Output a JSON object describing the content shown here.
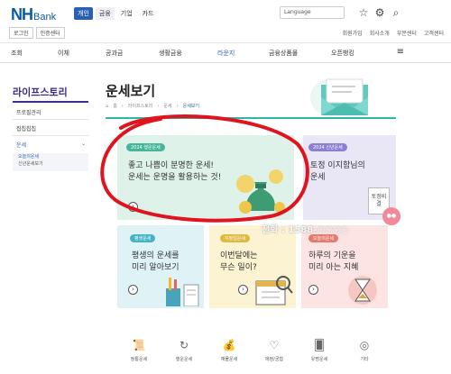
{
  "header": {
    "logo_main": "NH",
    "logo_sub": "Bank",
    "segments": [
      "개인",
      "금융",
      "기업",
      "카드"
    ],
    "login_buttons": [
      "로그인",
      "인증센터"
    ],
    "search_select": "Language",
    "util_links": [
      "회원가입",
      "회사소개",
      "부문센터",
      "고객센터"
    ]
  },
  "gnb": {
    "items": [
      "조회",
      "이체",
      "공과금",
      "생활금융",
      "라운지",
      "금융상품몰",
      "오픈뱅킹"
    ]
  },
  "sidebar": {
    "title": "라이프스토리",
    "items": [
      "프로필관리",
      "칩칩칩칩",
      "운세"
    ],
    "sub_items": [
      "오늘의운세",
      "신년운세보기"
    ]
  },
  "main": {
    "title": "운세보기",
    "breadcrumb": [
      "홈",
      "라이프스토리",
      "운세",
      "운세보기"
    ]
  },
  "cards": [
    {
      "badge": "2024 행운운세",
      "lines": [
        "좋고 나쁨이 분명한 운세!",
        "운세는 운명을 활용하는 것!"
      ],
      "button": "›"
    },
    {
      "badge": "2024 신년운세",
      "lines": [
        "토정 이지함님의",
        "운세"
      ],
      "button": "›",
      "book_label": "토정비결"
    },
    {
      "badge": "평생운세",
      "lines": [
        "평생의 운세를",
        "미리 알아보기"
      ],
      "button": "›"
    },
    {
      "badge": "지정일운세",
      "lines": [
        "이번달에는",
        "무슨 일이?"
      ],
      "button": "›"
    },
    {
      "badge": "오늘의운세",
      "lines": [
        "하루의 기운을",
        "미리 아는 지혜"
      ],
      "button": "›"
    }
  ],
  "footer_icons": [
    {
      "label": "정통운세",
      "icon": "scroll-icon"
    },
    {
      "label": "행운운세",
      "icon": "refresh-icon"
    },
    {
      "label": "재물운세",
      "icon": "money-bag-icon"
    },
    {
      "label": "애정/궁합",
      "icon": "heart-hand-icon"
    },
    {
      "label": "유명운세",
      "icon": "cards-icon"
    },
    {
      "label": "기타",
      "icon": "crystal-ball-icon"
    }
  ],
  "overlay": {
    "watermark_text": "전화 : 1588-○○○○",
    "annotation_color": "#e0141e"
  }
}
